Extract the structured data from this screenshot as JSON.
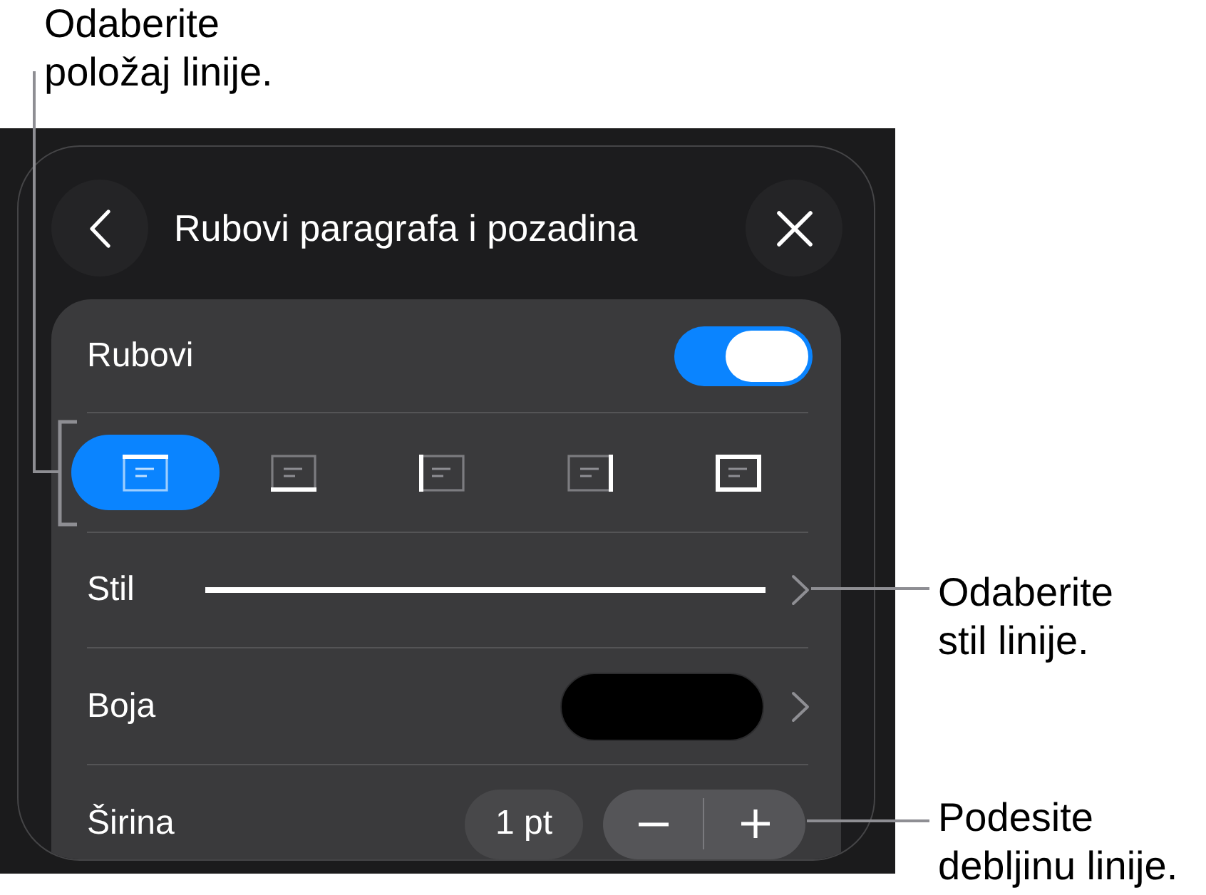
{
  "callouts": [
    {
      "text": "Odaberite položaj linije."
    },
    {
      "text": "Odaberite stil linije."
    },
    {
      "text": "Podesite debljinu linije."
    }
  ],
  "panel": {
    "title": "Rubovi paragrafa i pozadina",
    "borders": {
      "label": "Rubovi",
      "on": true
    },
    "positions": [
      {
        "kind": "top",
        "selected": true
      },
      {
        "kind": "bottom",
        "selected": false
      },
      {
        "kind": "left",
        "selected": false
      },
      {
        "kind": "right",
        "selected": false
      },
      {
        "kind": "box",
        "selected": false
      }
    ],
    "style": {
      "label": "Stil"
    },
    "color": {
      "label": "Boja",
      "color": "#000000"
    },
    "width": {
      "label": "Širina",
      "value": "1 pt"
    }
  }
}
